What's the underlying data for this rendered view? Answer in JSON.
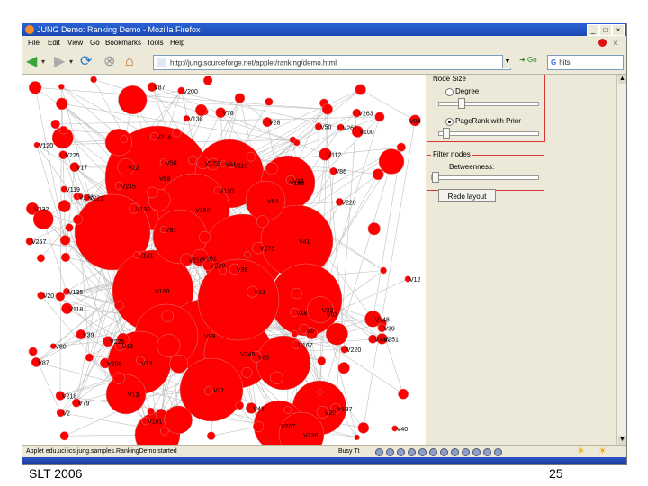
{
  "browser": {
    "title": "JUNG Demo: Ranking Demo - Mozilla Firefox",
    "window_buttons": [
      "_",
      "□",
      "×"
    ],
    "menu": [
      "File",
      "Edit",
      "View",
      "Go",
      "Bookmarks",
      "Tools",
      "Help"
    ],
    "url": "http://jung.sourceforge.net/applet/ranking/demo.html",
    "go_label": "Go",
    "search_value": "hits",
    "search_engine": "G"
  },
  "panel": {
    "node_size_title": "Node Size",
    "option_degree": "Degree",
    "option_pagerank": "PageRank with Prior",
    "selected_option": "PageRank with Prior",
    "filter_title": "Filter nodes",
    "betweenness_label": "Betweenness:",
    "relayout_button": "Redo layout"
  },
  "status": {
    "left_text": "Applet edu.uci.ics.jung.samples.RankingDemo.started",
    "right_text": "Busy Tt"
  },
  "slide": {
    "footer_left": "SLT 2006",
    "page_number": "25"
  },
  "graph": {
    "node_color": "#ff0000",
    "edge_color": "#c0c0c0",
    "labels": [
      "V150",
      "V245",
      "V236",
      "V218",
      "V173",
      "V161",
      "V232",
      "V100",
      "V130",
      "V137",
      "V87",
      "V80",
      "V225",
      "V38",
      "V130",
      "V43",
      "V221",
      "V226",
      "V39",
      "V263",
      "V148",
      "V112",
      "V141",
      "V206",
      "V261",
      "V180",
      "V13",
      "V54",
      "V81",
      "V2",
      "V50",
      "V276",
      "V245",
      "V20",
      "V12",
      "V13",
      "V200",
      "V214",
      "V20",
      "V76",
      "V181",
      "V220",
      "V257",
      "V13",
      "V120",
      "V80",
      "V220",
      "V135",
      "V251",
      "V98",
      "V41",
      "V21",
      "V13",
      "V40",
      "V63",
      "V33",
      "V6",
      "V138",
      "V79",
      "V240",
      "V91",
      "V50",
      "V39",
      "V22",
      "V119",
      "V176",
      "V86",
      "V87",
      "V110",
      "V28",
      "V220",
      "V84",
      "V216",
      "V118",
      "V180",
      "V89",
      "V207",
      "V17",
      "V44",
      "V18",
      "V167"
    ]
  }
}
